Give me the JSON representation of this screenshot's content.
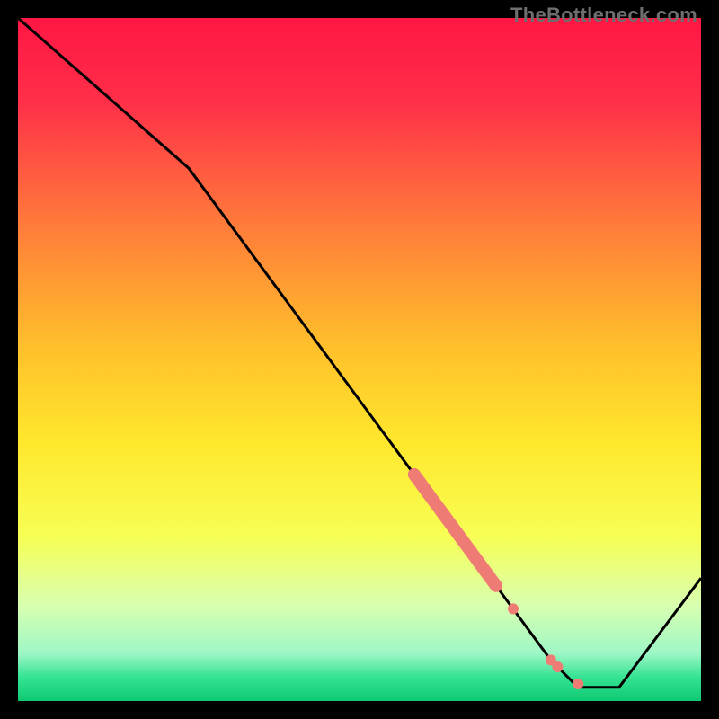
{
  "watermark": "TheBottleneck.com",
  "chart_data": {
    "type": "line",
    "title": "",
    "xlabel": "",
    "ylabel": "",
    "xlim": [
      0,
      100
    ],
    "ylim": [
      0,
      100
    ],
    "series": [
      {
        "name": "curve",
        "x": [
          0,
          25,
          78,
          82,
          88,
          100
        ],
        "y": [
          100,
          78,
          6,
          2,
          2,
          18
        ]
      }
    ],
    "highlight_segment": {
      "x_start": 58,
      "x_end": 70,
      "note": "thick salmon overlay on main curve"
    },
    "highlight_points": [
      {
        "x": 72.5,
        "y": 13.5
      },
      {
        "x": 78,
        "y": 6
      },
      {
        "x": 79,
        "y": 5
      },
      {
        "x": 82,
        "y": 2.5
      }
    ],
    "background_gradient": {
      "stops": [
        {
          "t": 0.0,
          "color": "#ff1744"
        },
        {
          "t": 0.12,
          "color": "#ff2e49"
        },
        {
          "t": 0.3,
          "color": "#ff7a3a"
        },
        {
          "t": 0.48,
          "color": "#ffbf2b"
        },
        {
          "t": 0.62,
          "color": "#ffe72c"
        },
        {
          "t": 0.76,
          "color": "#f7ff55"
        },
        {
          "t": 0.86,
          "color": "#d8ffb0"
        },
        {
          "t": 0.93,
          "color": "#9ef7c6"
        },
        {
          "t": 0.965,
          "color": "#35e393"
        },
        {
          "t": 1.0,
          "color": "#0fc972"
        }
      ]
    }
  }
}
